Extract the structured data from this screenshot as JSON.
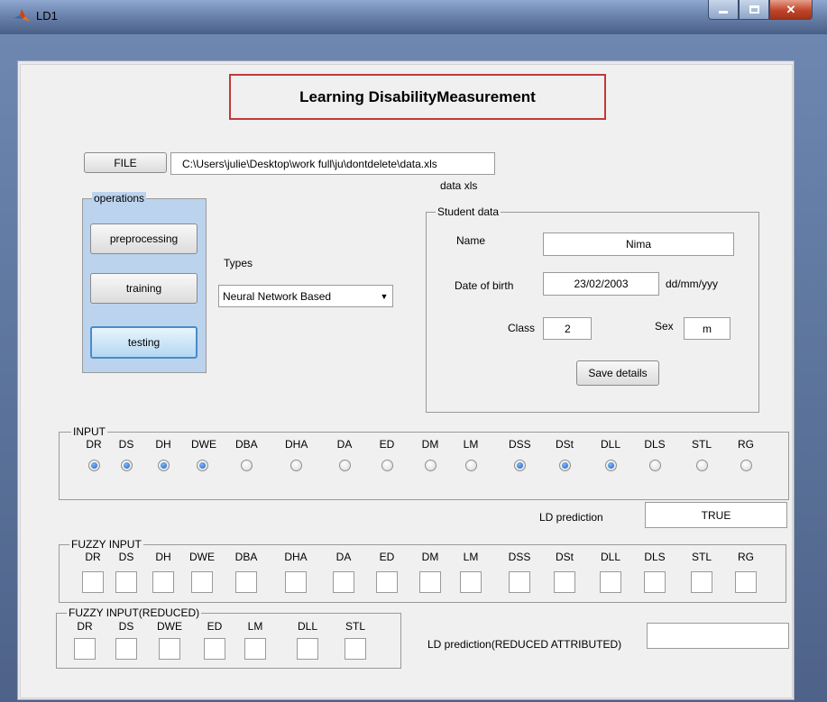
{
  "window": {
    "title": "LD1"
  },
  "header_title": "Learning DisabilityMeasurement",
  "file": {
    "button_label": "FILE",
    "path": "C:\\Users\\julie\\Desktop\\work full\\ju\\dontdelete\\data.xls",
    "sub_label": "data xls"
  },
  "operations": {
    "title": "operations",
    "buttons": [
      "preprocessing",
      "training",
      "testing"
    ]
  },
  "types": {
    "label": "Types",
    "selected": "Neural Network Based"
  },
  "student": {
    "title": "Student data",
    "name_label": "Name",
    "name_value": "Nima",
    "dob_label": "Date of birth",
    "dob_value": "23/02/2003",
    "dob_format": "dd/mm/yyy",
    "class_label": "Class",
    "class_value": "2",
    "sex_label": "Sex",
    "sex_value": "m",
    "save_label": "Save details"
  },
  "input": {
    "title": "INPUT",
    "labels": [
      "DR",
      "DS",
      "DH",
      "DWE",
      "DBA",
      "DHA",
      "DA",
      "ED",
      "DM",
      "LM",
      "DSS",
      "DSt",
      "DLL",
      "DLS",
      "STL",
      "RG"
    ],
    "selected": [
      true,
      true,
      true,
      true,
      false,
      false,
      false,
      false,
      false,
      false,
      true,
      true,
      true,
      false,
      false,
      false
    ]
  },
  "prediction": {
    "label": "LD prediction",
    "value": "TRUE"
  },
  "fuzzy": {
    "title": "FUZZY INPUT",
    "labels": [
      "DR",
      "DS",
      "DH",
      "DWE",
      "DBA",
      "DHA",
      "DA",
      "ED",
      "DM",
      "LM",
      "DSS",
      "DSt",
      "DLL",
      "DLS",
      "STL",
      "RG"
    ]
  },
  "fuzzy_reduced": {
    "title": "FUZZY INPUT(REDUCED)",
    "labels": [
      "DR",
      "DS",
      "DWE",
      "ED",
      "LM",
      "DLL",
      "STL"
    ]
  },
  "prediction_reduced": {
    "label": "LD prediction(REDUCED ATTRIBUTED)",
    "value": ""
  }
}
